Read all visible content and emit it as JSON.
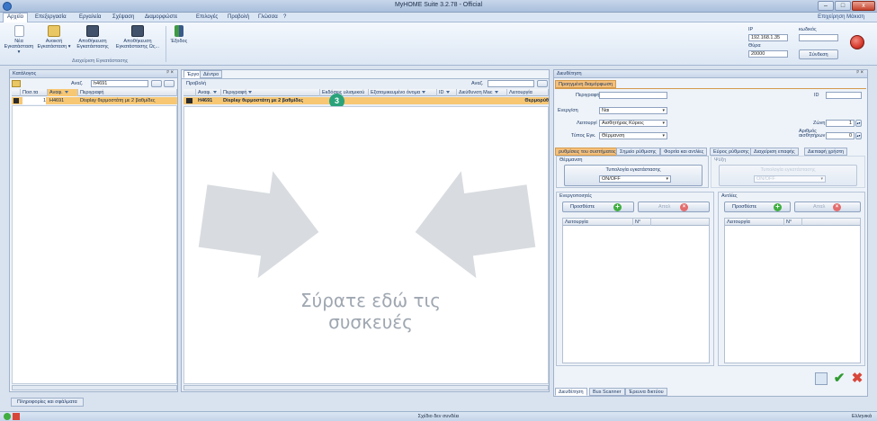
{
  "window": {
    "title": "MyHOME Suite 3.2.78 - Official",
    "minimize": "–",
    "maximize": "□",
    "close": "x"
  },
  "menu": {
    "items": [
      "Αρχείο",
      "Επεξεργασία",
      "Εργαλεία",
      "Σχέψαση",
      "Διαμορφώστε",
      "Επιλογές",
      "Προβολή",
      "Γλώσσα",
      "?"
    ],
    "right_label": "Επιχείρηση Μάκιση"
  },
  "ribbon": {
    "buttons": [
      {
        "label": "Νέα Εγκατάσταση ▾"
      },
      {
        "label": "Ανοικτή Εγκατάσταση ▾"
      },
      {
        "label": "Αποθήκευση Εγκατάστασης"
      },
      {
        "label": "Αποθήκευση Εγκατάστασης Ως..."
      },
      {
        "label": "Έξοδος"
      }
    ],
    "group_label": "Διαχείριση Εγκατάστασης"
  },
  "connection": {
    "ip_label": "IP",
    "ip_value": "192.168.1.35",
    "port_label": "Θύρα",
    "port_value": "20000",
    "code_label": "κωδικός",
    "code_value": "",
    "connect_button": "Σύνδεση"
  },
  "catalog": {
    "title": "Κατάλογος",
    "search_label": "Αναζ.",
    "search_value": "h4691",
    "columns": [
      "Ποσ.τα",
      "Αναφ.",
      "Περιγραφή"
    ],
    "rows": [
      {
        "qty": "1",
        "ref": "H4691",
        "desc": "Display θερμοστάτη με 2 βαθμίδες"
      }
    ]
  },
  "project": {
    "tabs": [
      "Έργο",
      "Δέντρο"
    ],
    "view_label": "Προβολή",
    "search_label": "Αναζ.",
    "columns": [
      "Αναφ.",
      "Περιγραφή",
      "Εκδόσεις υλισμικού",
      "Εξατομικευμένο όνομα",
      "ID",
      "Διεύθυνση Mac",
      "Λειτουργία"
    ],
    "rows": [
      {
        "ref": "H4691",
        "desc": "Display θερμοστάτη με 2 βαθμίδες",
        "func": "Θερμορύθ"
      }
    ],
    "badge": "3",
    "drop_hint_line1": "Σύρατε εδώ τις",
    "drop_hint_line2": "συσκευές"
  },
  "config": {
    "title": "Διευθέτηση",
    "tab_top": "Προηγμένη διαμόρφωση",
    "description_label": "Περιγραφή",
    "description_value": "",
    "id_label": "ID",
    "id_value": "",
    "enabled_label": "Ενεργ/ση",
    "enabled_value": "Ναι",
    "function_label": "Λειτουργί",
    "function_value": "Αισθητήρας Κύριος",
    "zone_label": "Ζώνη",
    "zone_value": "1",
    "install_type_label": "Τύπος Εγκ.",
    "install_type_value": "Θέρμανση",
    "sensors_label": "Αριθμός αισθητήρων",
    "sensors_value": "0",
    "subtabs": [
      "ρυθμίσεις του συστήματος",
      "Σημείο ρύθμισης",
      "Φορτία και αντλίες",
      "Εύρος ρύθμισης",
      "Διαχείριση επαφής",
      "Διεπαφή χρήστη"
    ],
    "heating_label": "Θέρμανση",
    "cooling_label": "Ψύξη",
    "topology_label": "Τυπολογία εγκατάστασης",
    "topology_value": "ON/OFF",
    "topology_cool_label": "Τυπολογία εγκατάστασης",
    "topology_cool_value": "ON/OFF",
    "actuators_label": "Ενεργοποιητές",
    "pumps_label": "Αντλίες",
    "add_label": "Προσθέστε",
    "remove_label": "Απαλ",
    "list_col_function": "Λειτουργία",
    "list_col_number": "N°",
    "bottom_tabs": [
      "Διευθέτηση",
      "Bus Scanner",
      "Έρευνα δικτύου"
    ]
  },
  "footer": {
    "info_tab": "Πληροφορίες και σφάλματα",
    "status_text": "Σχέδιο δεν συνδέει",
    "language": "Ελληνικά"
  },
  "colors": {
    "accent_orange": "#f7c773",
    "title_bar": "#c7d6ea",
    "connect_indicator": "#d83a2e"
  }
}
